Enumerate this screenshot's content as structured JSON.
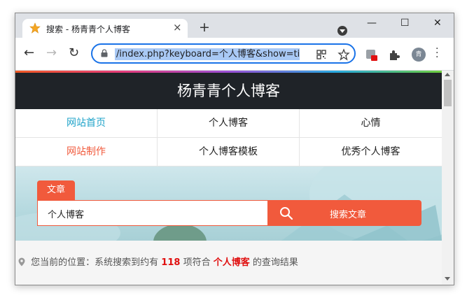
{
  "browser": {
    "tab_title": "搜索 - 杨青青个人博客",
    "tab_close": "×",
    "new_tab": "+",
    "window_controls": {
      "minimize": "—",
      "maximize": "☐",
      "close": "✕"
    },
    "url": "/index.php?keyboard=个人博客&show=ti",
    "profile_initial": "青",
    "nav": {
      "back": "←",
      "forward": "→",
      "reload": "↻"
    }
  },
  "site": {
    "title": "杨青青个人博客",
    "nav_items": [
      {
        "label": "网站首页",
        "color": "#1fa3c9"
      },
      {
        "label": "个人博客",
        "color": "#222222"
      },
      {
        "label": "心情",
        "color": "#222222"
      },
      {
        "label": "网站制作",
        "color": "#f15a3c"
      },
      {
        "label": "个人博客模板",
        "color": "#222222"
      },
      {
        "label": "优秀个人博客",
        "color": "#222222"
      }
    ],
    "search": {
      "tab_label": "文章",
      "value": "个人博客",
      "button_label": "搜索文章"
    },
    "location": {
      "prefix": "您当前的位置：系统搜索到约有",
      "count": "118",
      "middle": "项符合",
      "keyword": "个人博客",
      "suffix": "的查询结果"
    }
  },
  "colors": {
    "accent": "#f15a3c",
    "header_bg": "#1f2328",
    "link_blue": "#1fa3c9",
    "highlight_red": "#e01010"
  }
}
